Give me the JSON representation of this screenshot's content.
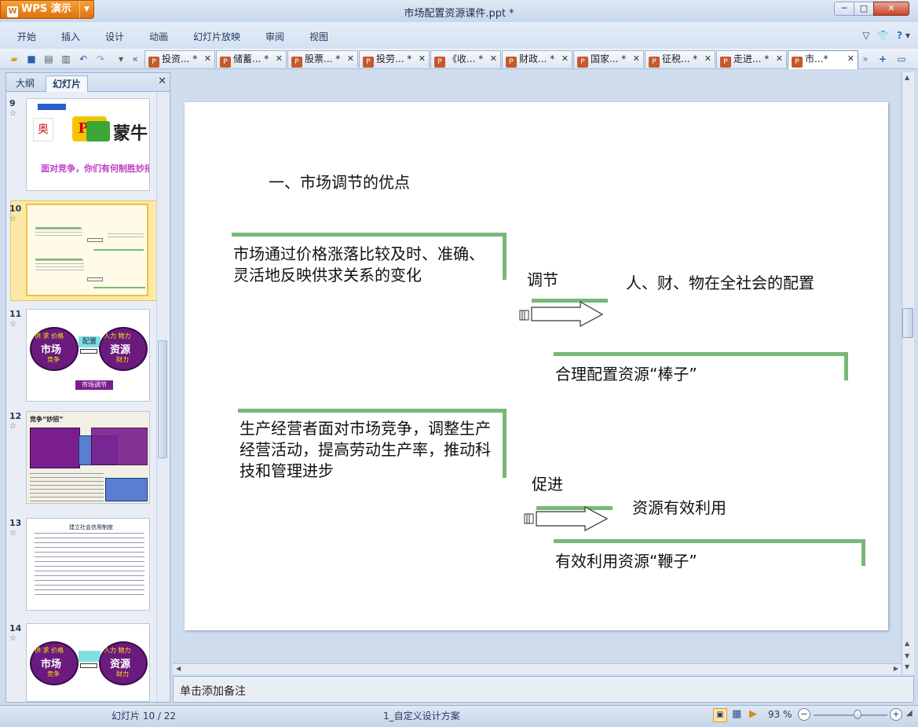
{
  "app": {
    "name": "WPS 演示",
    "doc_title": "市场配置资源课件.ppt *"
  },
  "window": {
    "minimize": "─",
    "maximize": "□",
    "close": "✕"
  },
  "menu": [
    "开始",
    "插入",
    "设计",
    "动画",
    "幻灯片放映",
    "审阅",
    "视图"
  ],
  "toolbar_icons": [
    "folder-open-icon",
    "save-icon",
    "print-icon",
    "print-preview-icon",
    "undo-icon",
    "redo-icon",
    "dropdown-icon",
    "tab-scroll-left-icon"
  ],
  "doc_tabs": [
    {
      "label": "投资... *"
    },
    {
      "label": "储蓄... *"
    },
    {
      "label": "股票... *"
    },
    {
      "label": "投劳... *"
    },
    {
      "label": "《收... *"
    },
    {
      "label": "财政... *"
    },
    {
      "label": "国家... *"
    },
    {
      "label": "征税... *"
    },
    {
      "label": "走进... *"
    },
    {
      "label": "市...*"
    }
  ],
  "panel": {
    "tab_outline": "大纲",
    "tab_slides": "幻灯片",
    "close": "✕"
  },
  "thumbnails": [
    {
      "num": "9",
      "star": "☆",
      "caption": "面对竞争，你们有何制胜妙招？",
      "logo": "蒙牛",
      "pk": "PK"
    },
    {
      "num": "10",
      "star": "☆",
      "selected": true
    },
    {
      "num": "11",
      "star": "☆",
      "left_title": "供 求 价格",
      "left_main": "市场",
      "left_sub": "竞争",
      "mid": "配置",
      "right_title": "人力 物力",
      "right_main": "资源",
      "right_sub": "财力",
      "callout": "市场调节"
    },
    {
      "num": "12",
      "star": "☆",
      "title": "竞争“妙招”"
    },
    {
      "num": "13",
      "star": "☆",
      "title": "建立社会信用制度"
    },
    {
      "num": "14",
      "star": "☆",
      "left_title": "供 求 价格",
      "left_main": "市场",
      "left_sub": "竞争",
      "right_title": "人力 物力",
      "right_main": "资源",
      "right_sub": "财力"
    }
  ],
  "slide": {
    "heading": "一、市场调节的优点",
    "box1": "市场通过价格涨落比较及时、准确、灵活地反映供求关系的变化",
    "arrow1_label": "调节",
    "target1": "人、财、物在全社会的配置",
    "result1": "合理配置资源“棒子”",
    "box2": "生产经营者面对市场竞争，调整生产经营活动，提高劳动生产率，推动科技和管理进步",
    "arrow2_label": "促进",
    "target2": "资源有效利用",
    "result2": "有效利用资源“鞭子”",
    "accent_color": "#77b877"
  },
  "notes_placeholder": "单击添加备注",
  "status": {
    "slide_pos": "幻灯片 10 / 22",
    "theme": "1_自定义设计方案",
    "zoom": "93 %",
    "zoom_level": 0.6
  }
}
